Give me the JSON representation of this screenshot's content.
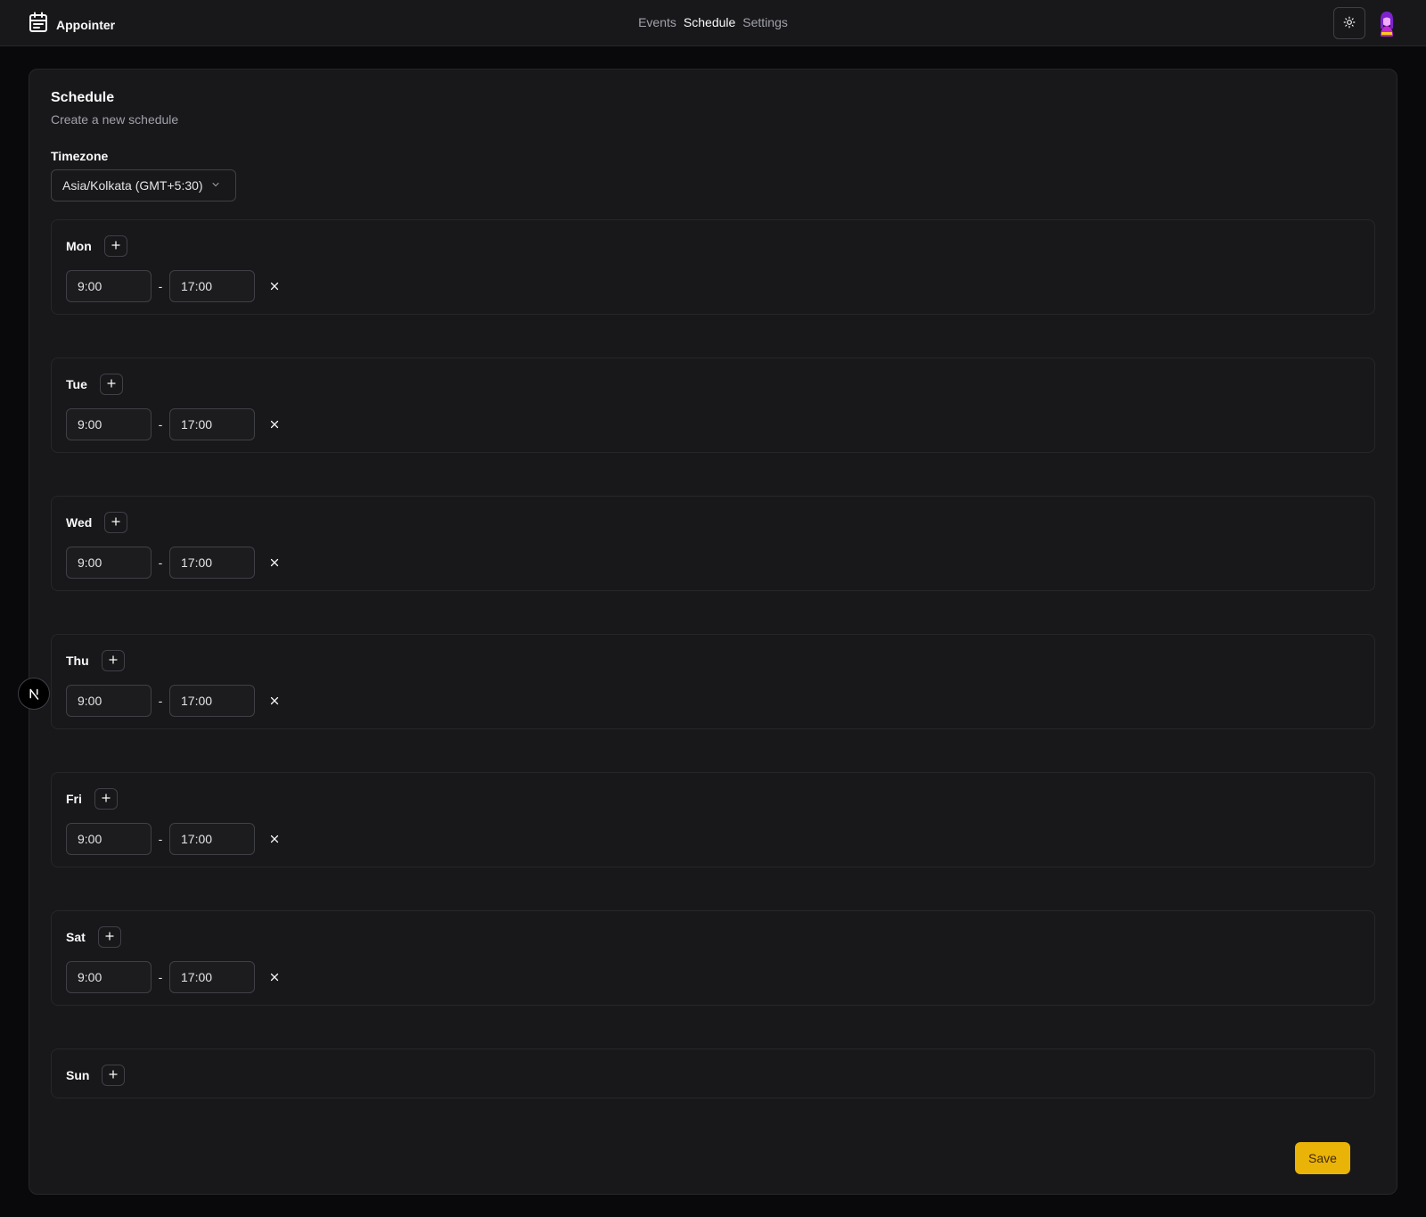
{
  "app": {
    "name": "Appointer"
  },
  "nav": [
    {
      "label": "Events",
      "active": false
    },
    {
      "label": "Schedule",
      "active": true
    },
    {
      "label": "Settings",
      "active": false
    }
  ],
  "page": {
    "title": "Schedule",
    "subtitle": "Create a new schedule"
  },
  "timezone": {
    "label": "Timezone",
    "value": "Asia/Kolkata (GMT+5:30)"
  },
  "days": [
    {
      "name": "Mon",
      "slots": [
        {
          "start": "9:00",
          "end": "17:00"
        }
      ]
    },
    {
      "name": "Tue",
      "slots": [
        {
          "start": "9:00",
          "end": "17:00"
        }
      ]
    },
    {
      "name": "Wed",
      "slots": [
        {
          "start": "9:00",
          "end": "17:00"
        }
      ]
    },
    {
      "name": "Thu",
      "slots": [
        {
          "start": "9:00",
          "end": "17:00"
        }
      ]
    },
    {
      "name": "Fri",
      "slots": [
        {
          "start": "9:00",
          "end": "17:00"
        }
      ]
    },
    {
      "name": "Sat",
      "slots": [
        {
          "start": "9:00",
          "end": "17:00"
        }
      ]
    },
    {
      "name": "Sun",
      "slots": []
    }
  ],
  "slot_separator": "-",
  "actions": {
    "save_label": "Save"
  },
  "colors": {
    "accent": "#eab308",
    "background": "#09090b",
    "surface": "#18181b",
    "border": "#27272a"
  },
  "icons": {
    "logo": "calendar-icon",
    "theme": "sun-icon",
    "add": "plus-icon",
    "remove": "close-icon",
    "dropdown": "chevron-down-icon",
    "dev_badge": "nextjs-icon"
  }
}
